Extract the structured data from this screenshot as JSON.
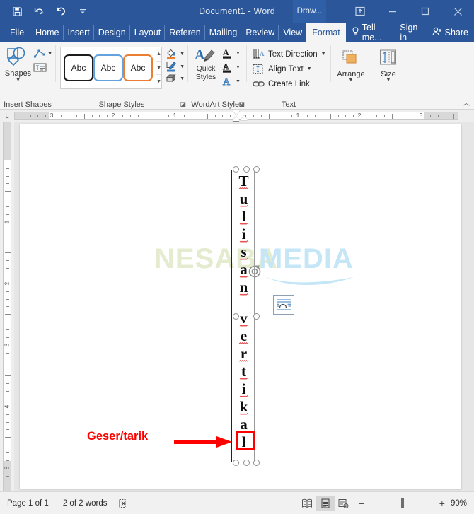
{
  "titlebar": {
    "document_title": "Document1 - Word",
    "context_tab": "Draw...",
    "qat": [
      {
        "name": "save",
        "icon": "save-icon"
      },
      {
        "name": "undo",
        "icon": "undo-icon"
      },
      {
        "name": "redo",
        "icon": "redo-icon"
      },
      {
        "name": "customize",
        "icon": "customize-qat-icon"
      }
    ],
    "window_controls": [
      {
        "name": "ribbon-display-options",
        "icon": "ribbon-display-icon"
      },
      {
        "name": "minimize",
        "icon": "minimize-icon"
      },
      {
        "name": "maximize",
        "icon": "maximize-icon"
      },
      {
        "name": "close",
        "icon": "close-icon"
      }
    ],
    "accent_color": "#2b579a"
  },
  "tabs": {
    "file": "File",
    "items": [
      {
        "label": "Home",
        "active": false
      },
      {
        "label": "Insert",
        "active": false
      },
      {
        "label": "Design",
        "active": false
      },
      {
        "label": "Layout",
        "active": false
      },
      {
        "label": "Referen",
        "active": false
      },
      {
        "label": "Mailing",
        "active": false
      },
      {
        "label": "Review",
        "active": false
      },
      {
        "label": "View",
        "active": false
      },
      {
        "label": "Format",
        "active": true
      }
    ],
    "tell_me": "Tell me...",
    "sign_in": "Sign in",
    "share": "Share"
  },
  "ribbon": {
    "insert_shapes": {
      "group_label": "Insert Shapes",
      "shapes_label": "Shapes",
      "edit_shape_icon": "edit-shape-icon",
      "text_box_icon": "draw-text-box-icon"
    },
    "shape_styles": {
      "group_label": "Shape Styles",
      "gallery": [
        {
          "label": "Abc",
          "outline": "#1c1c1c"
        },
        {
          "label": "Abc",
          "outline": "#62a2de"
        },
        {
          "label": "Abc",
          "outline": "#ed7d31"
        }
      ],
      "shape_fill_icon": "shape-fill-icon",
      "shape_outline_icon": "shape-outline-icon",
      "shape_effects_icon": "shape-effects-icon",
      "fill_color": "#ed7d31",
      "outline_color": "#3a7ebf"
    },
    "wordart_styles": {
      "group_label": "WordArt Styles",
      "quick_styles_label": "Quick Styles",
      "text_fill_icon": "text-fill-icon",
      "text_outline_icon": "text-outline-icon",
      "text_effects_icon": "text-effects-icon"
    },
    "text": {
      "group_label": "Text",
      "items": [
        {
          "label": "Text Direction",
          "icon": "text-direction-icon",
          "caret": true
        },
        {
          "label": "Align Text",
          "icon": "align-text-icon",
          "caret": true
        },
        {
          "label": "Create Link",
          "icon": "create-link-icon",
          "caret": false
        }
      ]
    },
    "arrange": {
      "label": "Arrange",
      "icon": "arrange-icon"
    },
    "size": {
      "label": "Size",
      "icon": "size-icon"
    },
    "collapse_icon": "collapse-ribbon-icon"
  },
  "rulers": {
    "horizontal_left": [
      "3",
      "2",
      "1"
    ],
    "horizontal_right": [
      "1",
      "2",
      "3"
    ],
    "vertical": [
      "1",
      "2",
      "3",
      "4",
      "5"
    ]
  },
  "document": {
    "watermark": {
      "part1": "NESABA",
      "part2": "MEDIA",
      "color1": "#e4ebcf",
      "color2": "#c5e6f7"
    },
    "text_box": {
      "word1_chars": [
        "T",
        "u",
        "l",
        "i",
        "s",
        "a",
        "n"
      ],
      "word2_chars": [
        "v",
        "e",
        "r",
        "t",
        "i",
        "k",
        "a",
        "l"
      ],
      "spellcheck_color": "#e02020"
    },
    "rotate_handle_icon": "rotate-handle-icon",
    "layout_options_icon": "layout-options-icon",
    "annotation": {
      "text": "Geser/tarik",
      "color": "#ff0000"
    }
  },
  "statusbar": {
    "page": "Page 1 of 1",
    "words": "2 of 2 words",
    "proofing_icon": "proofing-errors-icon",
    "views": [
      {
        "name": "read-mode",
        "icon": "read-mode-icon",
        "active": false
      },
      {
        "name": "print-layout",
        "icon": "print-layout-icon",
        "active": true
      },
      {
        "name": "web-layout",
        "icon": "web-layout-icon",
        "active": false
      }
    ],
    "zoom_out": "−",
    "zoom_in": "+",
    "zoom_value": "90%"
  }
}
